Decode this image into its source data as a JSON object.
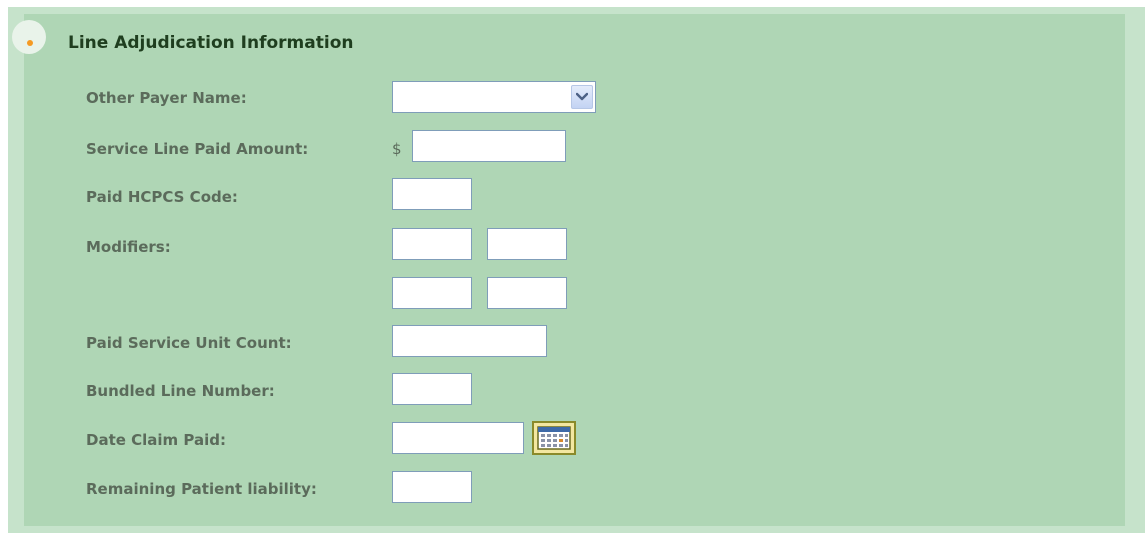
{
  "section": {
    "title": "Line Adjudication Information",
    "bullet_color": "#f59a23"
  },
  "fields": {
    "other_payer_name": {
      "label": "Other Payer Name:",
      "value": ""
    },
    "service_line_paid_amount": {
      "label": "Service Line Paid Amount:",
      "currency": "$",
      "value": ""
    },
    "paid_hcpcs_code": {
      "label": "Paid HCPCS Code:",
      "value": ""
    },
    "modifiers": {
      "label": "Modifiers:",
      "values": [
        "",
        "",
        "",
        ""
      ]
    },
    "paid_service_unit_count": {
      "label": "Paid Service Unit Count:",
      "value": ""
    },
    "bundled_line_number": {
      "label": "Bundled Line Number:",
      "value": ""
    },
    "date_claim_paid": {
      "label": "Date Claim Paid:",
      "value": "",
      "calendar_icon": "calendar-icon"
    },
    "remaining_patient_liability": {
      "label": "Remaining Patient liability:",
      "value": ""
    }
  },
  "colors": {
    "panel_background": "#afd6b5",
    "outer_background": "#c6e3cb",
    "label_text": "#5b6b5b",
    "title_text": "#1f3e1f",
    "input_border": "#7f9db9"
  }
}
